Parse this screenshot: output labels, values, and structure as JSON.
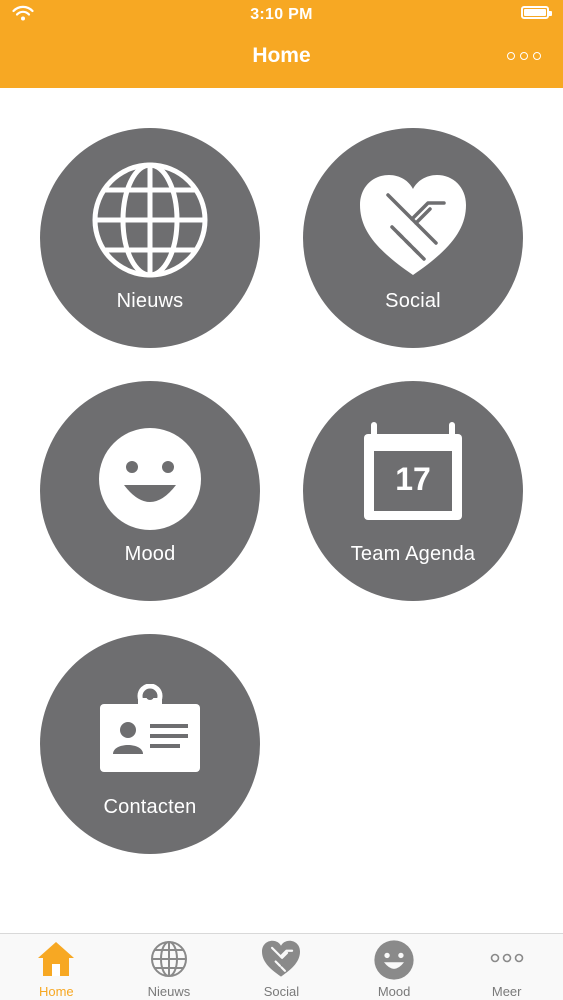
{
  "status_bar": {
    "time": "3:10 PM"
  },
  "header": {
    "title": "Home"
  },
  "tiles": [
    {
      "label": "Nieuws",
      "icon": "globe-icon"
    },
    {
      "label": "Social",
      "icon": "handshake-heart-icon"
    },
    {
      "label": "Mood",
      "icon": "smiley-icon"
    },
    {
      "label": "Team Agenda",
      "icon": "calendar-icon",
      "icon_text": "17"
    },
    {
      "label": "Contacten",
      "icon": "id-badge-icon"
    }
  ],
  "tabbar": {
    "items": [
      {
        "label": "Home",
        "icon": "home-icon",
        "active": true
      },
      {
        "label": "Nieuws",
        "icon": "globe-icon"
      },
      {
        "label": "Social",
        "icon": "handshake-heart-icon"
      },
      {
        "label": "Mood",
        "icon": "smiley-icon"
      },
      {
        "label": "Meer",
        "icon": "more-dots-icon"
      }
    ]
  },
  "colors": {
    "accent": "#F7A823",
    "tile": "#6E6E70",
    "tab_inactive": "#8a8a8a"
  }
}
